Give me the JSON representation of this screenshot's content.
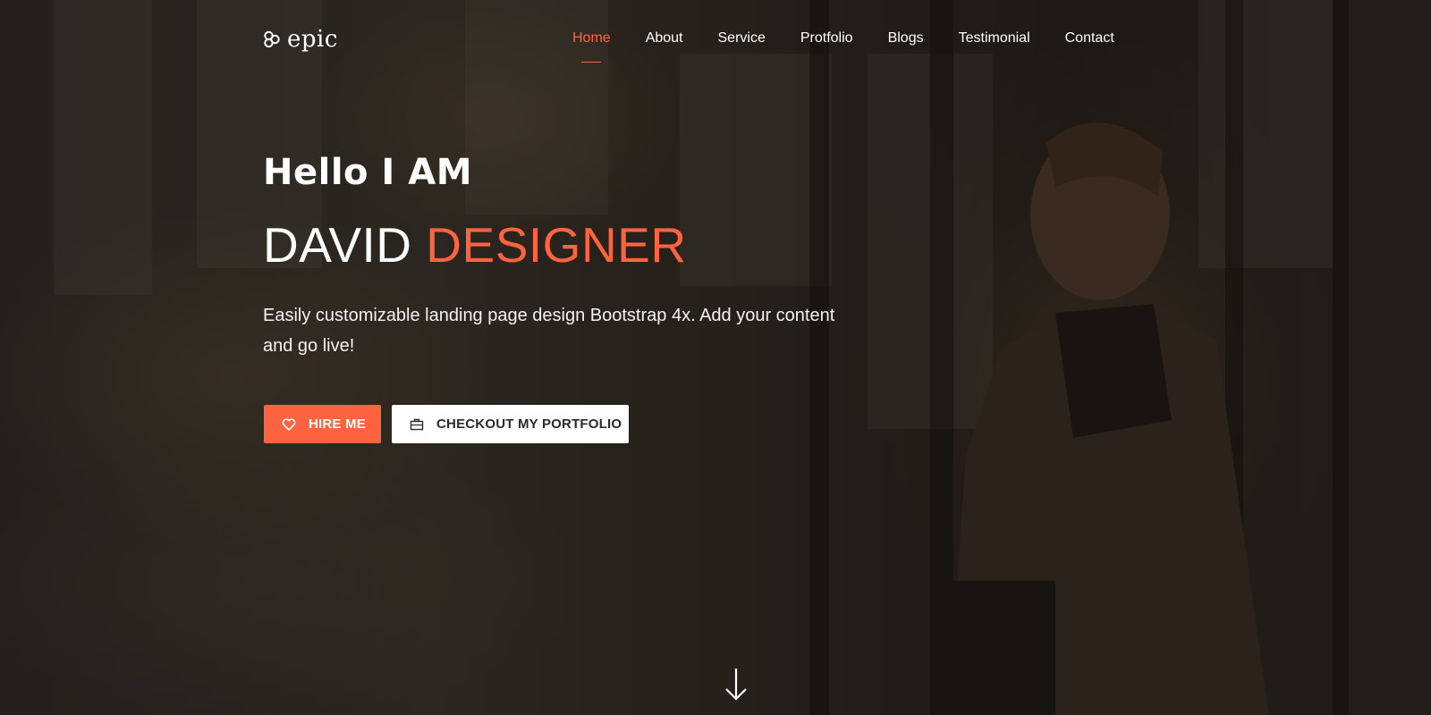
{
  "brand": {
    "logo_text": "epic",
    "logo_icon": "hexagon-cluster-icon"
  },
  "nav": {
    "items": [
      {
        "label": "Home",
        "active": true
      },
      {
        "label": "About",
        "active": false
      },
      {
        "label": "Service",
        "active": false
      },
      {
        "label": "Protfolio",
        "active": false
      },
      {
        "label": "Blogs",
        "active": false
      },
      {
        "label": "Testimonial",
        "active": false
      },
      {
        "label": "Contact",
        "active": false
      }
    ]
  },
  "hero": {
    "greeting": "Hello I AM",
    "name_first": "DAVID",
    "name_accent": "DESIGNER",
    "description": "Easily customizable landing page design Bootstrap 4x. Add your content and go live!",
    "hire_button": {
      "label": "HIRE ME",
      "icon": "heart-icon"
    },
    "portfolio_button": {
      "label": "CHECKOUT MY PORTFOLIO",
      "icon": "briefcase-icon"
    },
    "scroll_icon": "arrow-down-icon"
  },
  "colors": {
    "accent": "#ff6340",
    "text": "#ffffff",
    "overlay": "#121010"
  }
}
